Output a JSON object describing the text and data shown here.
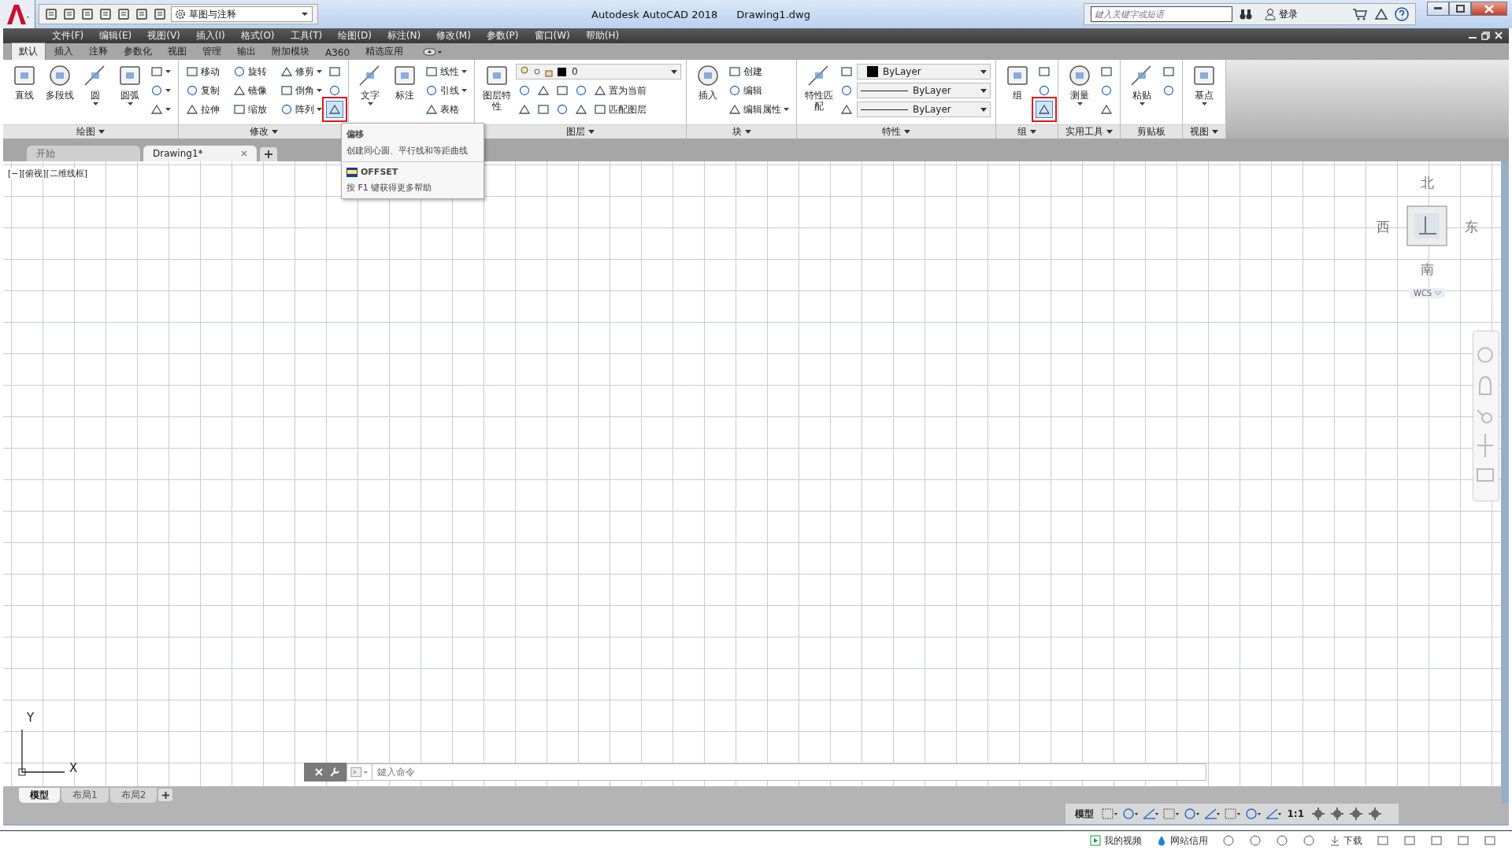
{
  "window": {
    "title": "Autodesk AutoCAD 2018",
    "document": "Drawing1.dwg"
  },
  "workspace": {
    "value": "草图与注释"
  },
  "search": {
    "placeholder": "鍵入关键字或短语"
  },
  "login": "登录",
  "menu_bar": [
    "文件(F)",
    "编辑(E)",
    "视图(V)",
    "插入(I)",
    "格式(O)",
    "工具(T)",
    "绘图(D)",
    "标注(N)",
    "修改(M)",
    "参数(P)",
    "窗口(W)",
    "帮助(H)"
  ],
  "ribbon_tabs": [
    {
      "label": "默认",
      "selected": true
    },
    {
      "label": "插入",
      "selected": false
    },
    {
      "label": "注释",
      "selected": false
    },
    {
      "label": "参数化",
      "selected": false
    },
    {
      "label": "视图",
      "selected": false
    },
    {
      "label": "管理",
      "selected": false
    },
    {
      "label": "输出",
      "selected": false
    },
    {
      "label": "附加模块",
      "selected": false
    },
    {
      "label": "A360",
      "selected": false
    },
    {
      "label": "精选应用",
      "selected": false
    }
  ],
  "panels": [
    {
      "title": "绘图",
      "menu": true,
      "large": [
        {
          "label": "直线",
          "kind": "large"
        },
        {
          "label": "多段线",
          "kind": "large"
        },
        {
          "label": "圆",
          "kind": "large_menu"
        },
        {
          "label": "圆弧",
          "kind": "large_menu"
        }
      ],
      "rows": [
        [
          {
            "kind": "icon_menu"
          }
        ],
        [
          {
            "kind": "icon_menu"
          }
        ],
        [
          {
            "kind": "icon_menu"
          }
        ]
      ]
    },
    {
      "title": "修改",
      "menu": true,
      "rows": [
        [
          {
            "label": "移动",
            "kind": "small",
            "highlighted": false
          },
          {
            "label": "旋转",
            "kind": "small",
            "highlighted": false
          },
          {
            "label": "修剪",
            "kind": "small_menu",
            "highlighted": false
          },
          {
            "kind": "icon",
            "highlighted": false
          }
        ],
        [
          {
            "label": "复制",
            "kind": "small",
            "highlighted": false
          },
          {
            "label": "镜像",
            "kind": "small",
            "highlighted": false
          },
          {
            "label": "倒角",
            "kind": "small_menu",
            "highlighted": false
          },
          {
            "kind": "icon",
            "highlighted": false
          }
        ],
        [
          {
            "label": "拉伸",
            "kind": "small",
            "highlighted": false
          },
          {
            "label": "缩放",
            "kind": "small",
            "highlighted": false
          },
          {
            "label": "阵列",
            "kind": "small_menu",
            "highlighted": false
          },
          {
            "kind": "icon",
            "highlighted": true
          }
        ]
      ]
    },
    {
      "large": [
        {
          "label": "文字",
          "kind": "large_menu"
        },
        {
          "label": "标注",
          "kind": "large"
        }
      ],
      "rows": [
        [
          {
            "label": "线性",
            "kind": "small_menu"
          }
        ],
        [
          {
            "label": "引线",
            "kind": "small_menu"
          }
        ],
        [
          {
            "label": "表格",
            "kind": "small"
          }
        ]
      ]
    },
    {
      "title": "图层",
      "menu": true,
      "large": [
        {
          "label": "图层特性",
          "kind": "large"
        }
      ],
      "rows": [
        [
          {
            "label": "0",
            "kind": "dropdown_layer"
          }
        ],
        [
          {
            "kind": "icon"
          },
          {
            "kind": "icon"
          },
          {
            "kind": "icon"
          },
          {
            "kind": "icon"
          },
          {
            "label": "置为当前",
            "kind": "small"
          }
        ],
        [
          {
            "kind": "icon"
          },
          {
            "kind": "icon"
          },
          {
            "kind": "icon"
          },
          {
            "kind": "icon"
          },
          {
            "label": "匹配图层",
            "kind": "small"
          }
        ]
      ]
    },
    {
      "title": "块",
      "menu": true,
      "large": [
        {
          "label": "插入",
          "kind": "large"
        }
      ],
      "rows": [
        [
          {
            "label": "创建",
            "kind": "small"
          }
        ],
        [
          {
            "label": "编辑",
            "kind": "small"
          }
        ],
        [
          {
            "label": "编辑属性",
            "kind": "small_menu"
          }
        ]
      ]
    },
    {
      "title": "特性",
      "menu": true,
      "large": [
        {
          "label": "特性匹配",
          "kind": "large"
        }
      ],
      "rows": [
        [
          {
            "kind": "icon"
          },
          {
            "label": "ByLayer",
            "kind": "dropdown_color"
          }
        ],
        [
          {
            "kind": "icon"
          },
          {
            "label": "ByLayer",
            "kind": "dropdown_line"
          }
        ],
        [
          {
            "kind": "icon"
          },
          {
            "label": "ByLayer",
            "kind": "dropdown_line"
          }
        ]
      ]
    },
    {
      "title": "组",
      "menu": true,
      "large": [
        {
          "label": "组",
          "kind": "large"
        }
      ],
      "rows": [
        [
          {
            "kind": "icon",
            "highlighted": false
          }
        ],
        [
          {
            "kind": "icon",
            "highlighted": false
          }
        ],
        [
          {
            "kind": "icon",
            "highlighted": true
          }
        ]
      ]
    },
    {
      "title": "实用工具",
      "menu": true,
      "large": [
        {
          "label": "测量",
          "kind": "large_menu"
        }
      ],
      "rows": [
        [
          {
            "kind": "icon"
          }
        ],
        [
          {
            "kind": "icon"
          }
        ],
        [
          {
            "kind": "icon"
          }
        ]
      ]
    },
    {
      "title": "剪贴板",
      "menu": false,
      "large": [
        {
          "label": "粘贴",
          "kind": "large_menu"
        }
      ],
      "rows": [
        [
          {
            "kind": "icon"
          }
        ],
        [
          {
            "kind": "icon"
          }
        ]
      ]
    },
    {
      "title": "视图",
      "menu": true,
      "large": [
        {
          "label": "基点",
          "kind": "large_menu"
        }
      ]
    }
  ],
  "tooltip": {
    "title": "偏移",
    "description": "创建同心圆、平行线和等距曲线",
    "command": "OFFSET",
    "help": "按 F1 键获得更多帮助"
  },
  "doc_tabs": [
    {
      "label": "开始",
      "selected": false
    },
    {
      "label": "Drawing1*",
      "selected": true
    }
  ],
  "viewport_label": "[−][俯视][二维线框]",
  "viewcube": {
    "north": "北",
    "south": "南",
    "west": "西",
    "east": "东",
    "ucs": "WCS"
  },
  "ucs_axes": {
    "x": "X",
    "y": "Y"
  },
  "command_line": {
    "placeholder": "鍵入命令"
  },
  "layout_tabs": [
    {
      "label": "模型",
      "selected": true
    },
    {
      "label": "布局1",
      "selected": false
    },
    {
      "label": "布局2",
      "selected": false
    }
  ],
  "status_bar": {
    "space": "模型",
    "scale": "1:1"
  },
  "browser_strip": [
    "我的视频",
    "网站信用",
    "下载"
  ]
}
